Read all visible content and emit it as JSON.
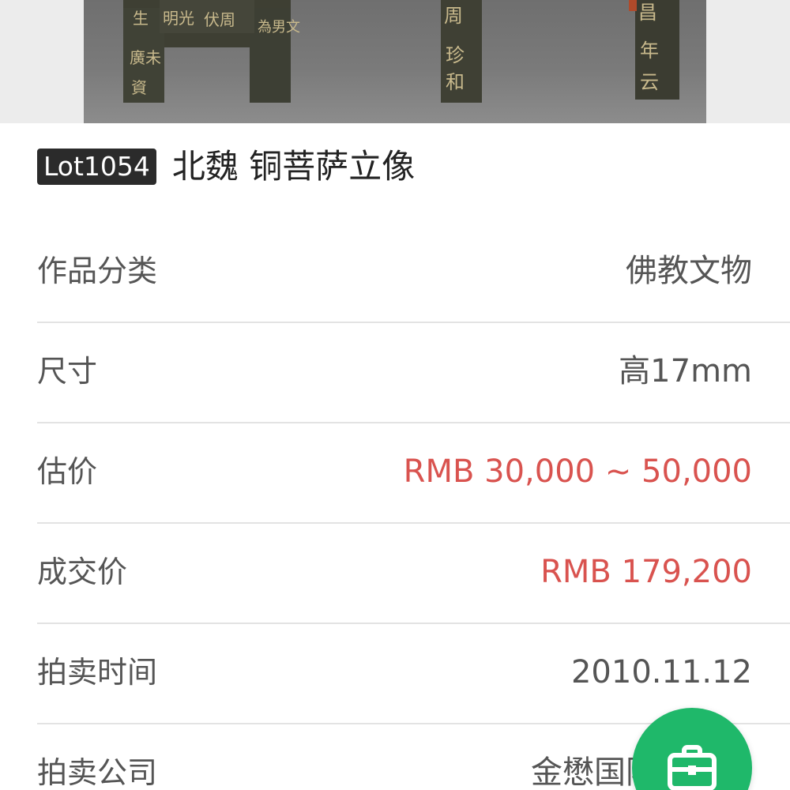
{
  "lot": {
    "badge": "Lot1054",
    "title": "北魏 铜菩萨立像"
  },
  "photo": {
    "subject": "bronze-bodhisattva-base-photo",
    "inscriptions": [
      "明光",
      "伏周",
      "為男文",
      "生",
      "廣未",
      "資",
      "周",
      "珍",
      "和",
      "昌",
      "年",
      "云"
    ]
  },
  "details": [
    {
      "label": "作品分类",
      "value": "佛教文物",
      "highlight": false
    },
    {
      "label": "尺寸",
      "value": "高17mm",
      "highlight": false
    },
    {
      "label": "估价",
      "value": "RMB 30,000 ~ 50,000",
      "highlight": true
    },
    {
      "label": "成交价",
      "value": "RMB 179,200",
      "highlight": true
    },
    {
      "label": "拍卖时间",
      "value": "2010.11.12",
      "highlight": false
    },
    {
      "label": "拍卖公司",
      "value": "金懋国际拍卖有",
      "highlight": false
    }
  ],
  "fab": {
    "icon": "briefcase-icon",
    "color": "#1fb86a"
  },
  "colors": {
    "price_red": "#d9534f",
    "badge_bg": "#2b2b2b"
  }
}
